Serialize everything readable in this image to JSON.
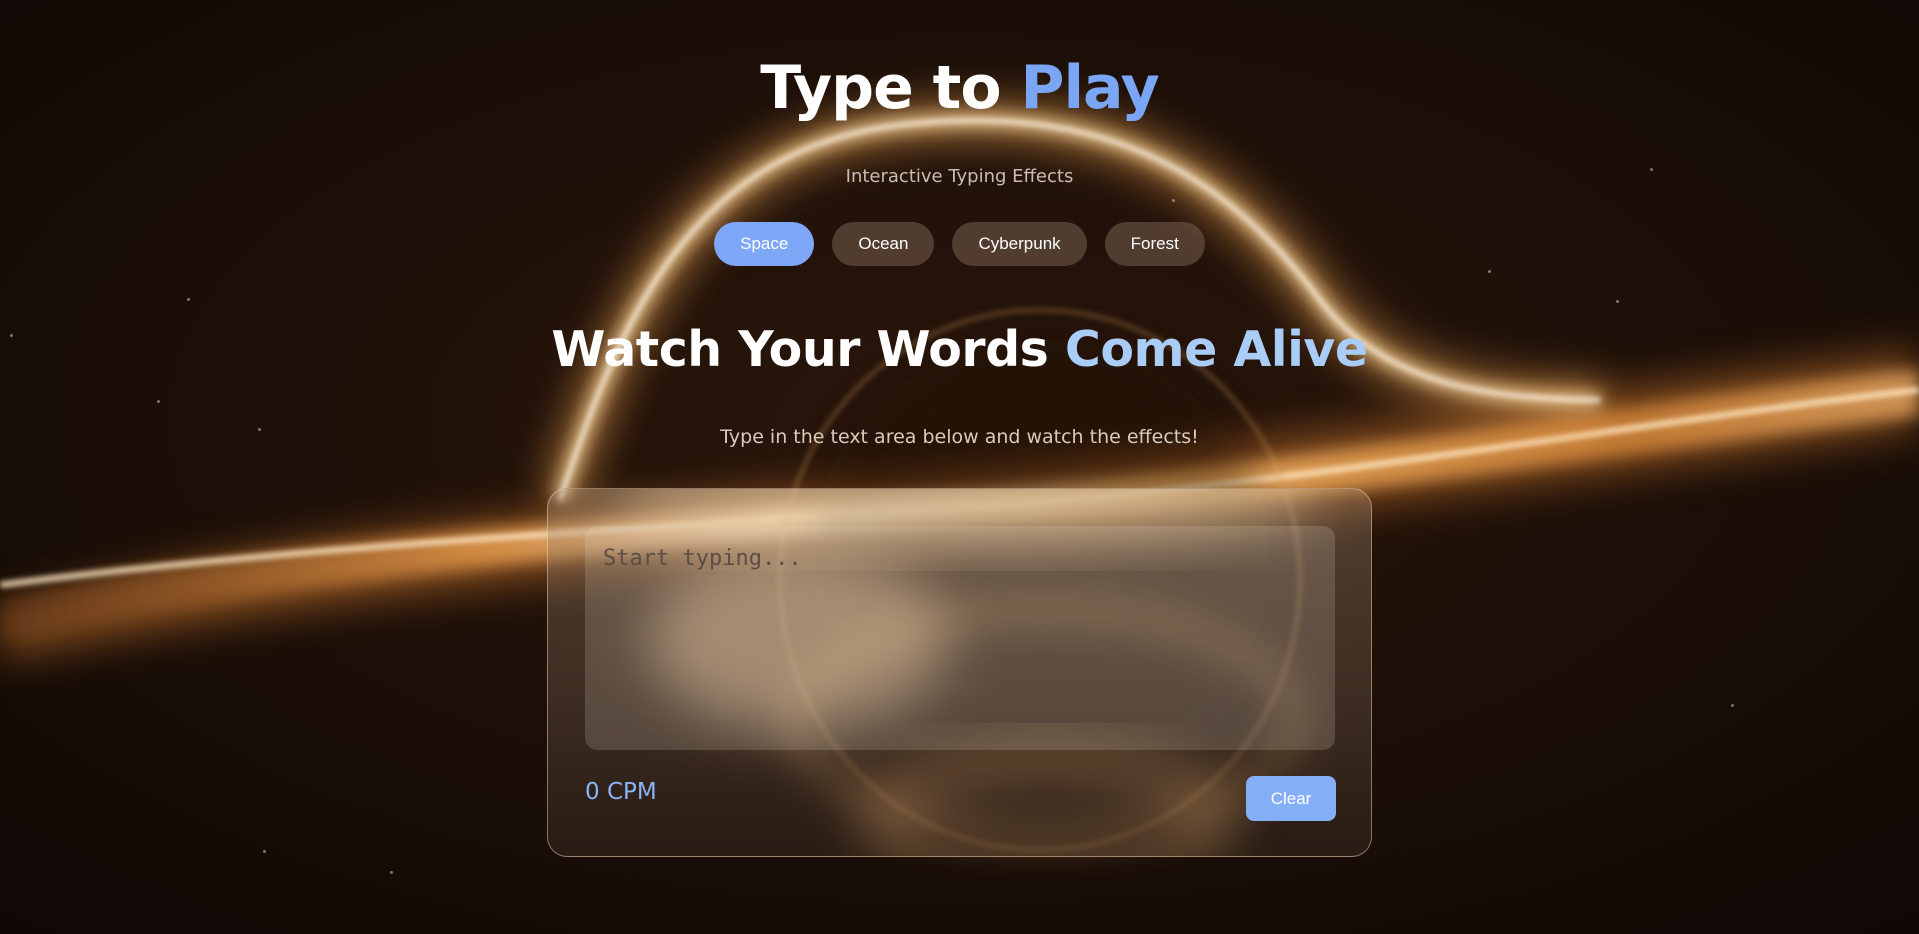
{
  "header": {
    "title_main": "Type to ",
    "title_accent": "Play",
    "subtitle": "Interactive Typing Effects"
  },
  "themes": [
    {
      "label": "Space",
      "active": true
    },
    {
      "label": "Ocean",
      "active": false
    },
    {
      "label": "Cyberpunk",
      "active": false
    },
    {
      "label": "Forest",
      "active": false
    }
  ],
  "hero": {
    "headline_main": "Watch Your Words ",
    "headline_accent": "Come Alive",
    "instruction": "Type in the text area below and watch the effects!"
  },
  "editor": {
    "placeholder": "Start typing...",
    "value": "",
    "cpm_label": "0 CPM",
    "clear_label": "Clear"
  },
  "colors": {
    "accent_blue": "#7ea7f7",
    "headline_accent": "#a9cdf6",
    "cpm_text": "#8ab4f8",
    "background": "#140b06"
  }
}
